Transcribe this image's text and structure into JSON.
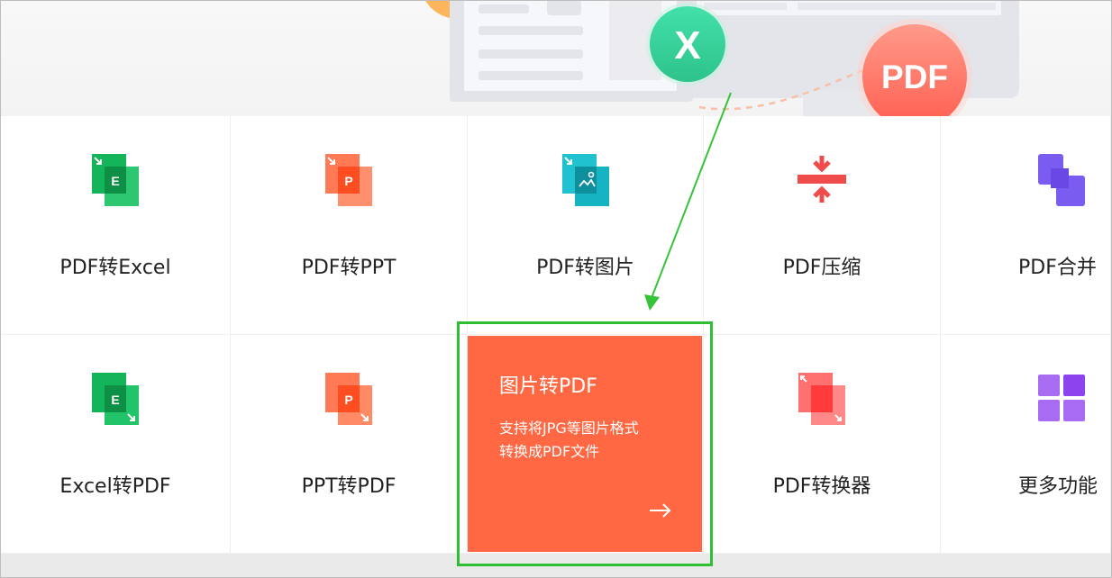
{
  "hero": {
    "excel_badge": "X",
    "pdf_badge": "PDF"
  },
  "tools": {
    "row1": [
      {
        "label": "PDF转Excel",
        "icon": "pdf-to-excel-icon"
      },
      {
        "label": "PDF转PPT",
        "icon": "pdf-to-ppt-icon"
      },
      {
        "label": "PDF转图片",
        "icon": "pdf-to-image-icon"
      },
      {
        "label": "PDF压缩",
        "icon": "compress-icon"
      },
      {
        "label": "PDF合并",
        "icon": "merge-icon"
      }
    ],
    "row2": [
      {
        "label": "Excel转PDF",
        "icon": "excel-to-pdf-icon"
      },
      {
        "label": "PPT转PDF",
        "icon": "ppt-to-pdf-icon"
      },
      {
        "label": "PDF转换器",
        "icon": "converter-icon"
      },
      {
        "label": "更多功能",
        "icon": "grid-icon"
      }
    ],
    "icon_letters": {
      "excel": "E",
      "ppt": "P"
    }
  },
  "feature_card": {
    "title": "图片转PDF",
    "desc_line1": "支持将JPG等图片格式",
    "desc_line2": "转换成PDF文件",
    "arrow": "→"
  },
  "colors": {
    "accent": "#ff6842",
    "highlight": "#2fbf34",
    "excel_green": "#13b45a",
    "ppt_orange": "#ff6b45",
    "image_teal": "#1fb6c4",
    "compress_red": "#f04b4b",
    "merge_purple": "#7b5cf0"
  }
}
